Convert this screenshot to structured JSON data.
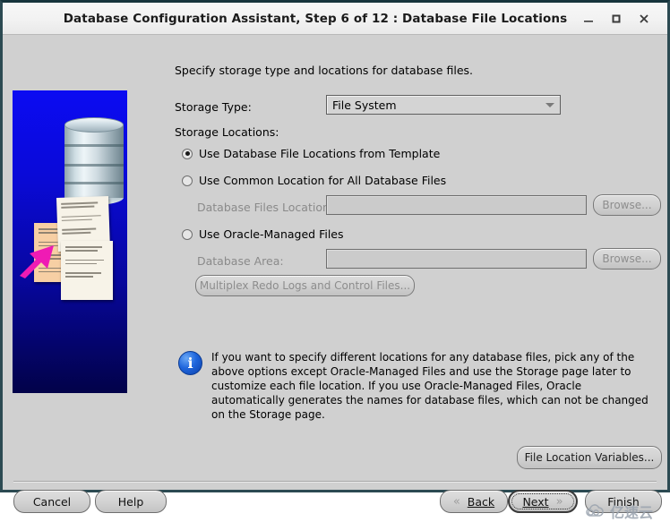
{
  "window": {
    "title": "Database Configuration Assistant, Step 6 of 12 : Database File Locations",
    "minimize_label": "–",
    "maximize_label": "□",
    "close_label": "✕"
  },
  "form": {
    "intro": "Specify storage type and locations for database files.",
    "storage_type_label": "Storage Type:",
    "storage_type_value": "File System",
    "storage_type_options": [
      "File System"
    ],
    "storage_locations_label": "Storage Locations:",
    "radio_template": "Use Database File Locations from Template",
    "radio_common": "Use Common Location for All Database Files",
    "radio_omf": "Use Oracle-Managed Files",
    "db_files_location_label": "Database Files Location:",
    "db_files_location_value": "",
    "db_area_label": "Database Area:",
    "db_area_value": "",
    "browse_label_1": "Browse...",
    "browse_label_2": "Browse...",
    "multiplex_label": "Multiplex Redo Logs and Control Files...",
    "file_location_variables_label": "File Location Variables..."
  },
  "info": {
    "icon": "info-icon",
    "text": "If you want to specify different locations for any database files, pick any of the above options except Oracle-Managed Files and use the Storage page later to customize each file location. If you use Oracle-Managed Files, Oracle automatically generates the names for database files, which can not be changed on the Storage page."
  },
  "footer": {
    "cancel": "Cancel",
    "help": "Help",
    "back": "Back",
    "next": "Next",
    "finish": "Finish",
    "back_chevron": "«",
    "next_chevron": "»"
  },
  "watermark": {
    "text": "亿速云"
  },
  "colors": {
    "window_frame": "#2c4a52",
    "panel_bg": "#d0d0d0",
    "info_blue": "#1f66dd",
    "sidebar_blue": "#0b0bf2",
    "arrow_magenta": "#ef1bb4"
  }
}
